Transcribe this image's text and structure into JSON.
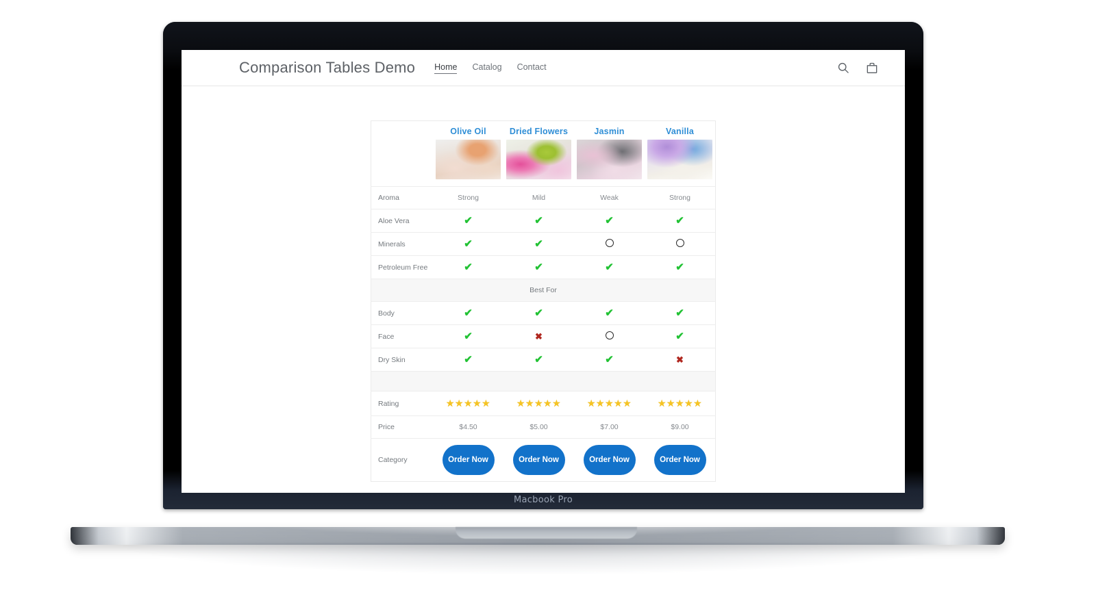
{
  "device": {
    "label": "Macbook Pro"
  },
  "header": {
    "brand": "Comparison Tables Demo",
    "nav": [
      {
        "label": "Home",
        "active": true
      },
      {
        "label": "Catalog",
        "active": false
      },
      {
        "label": "Contact",
        "active": false
      }
    ],
    "icons": [
      {
        "name": "search-icon",
        "label": "Search"
      },
      {
        "name": "shopping-bag-icon",
        "label": "Cart"
      }
    ]
  },
  "colors": {
    "product_title": "#2f8ed6",
    "check": "#22c234",
    "cross": "#b0271f",
    "star": "#f6c424",
    "button": "#1272ca",
    "section_band": "#f7f7f7"
  },
  "table": {
    "products": [
      {
        "name": "Olive Oil",
        "image": "olive-oil-soap-photo"
      },
      {
        "name": "Dried Flowers",
        "image": "dried-flowers-soap-photo"
      },
      {
        "name": "Jasmin",
        "image": "jasmin-soap-photo"
      },
      {
        "name": "Vanilla",
        "image": "vanilla-soap-photo"
      }
    ],
    "rows": [
      {
        "type": "text",
        "label": "Aroma",
        "values": [
          "Strong",
          "Mild",
          "Weak",
          "Strong"
        ]
      },
      {
        "type": "mark",
        "label": "Aloe Vera",
        "values": [
          "check",
          "check",
          "check",
          "check"
        ]
      },
      {
        "type": "mark",
        "label": "Minerals",
        "values": [
          "check",
          "check",
          "circle",
          "circle"
        ]
      },
      {
        "type": "mark",
        "label": "Petroleum Free",
        "values": [
          "check",
          "check",
          "check",
          "check"
        ]
      },
      {
        "type": "section",
        "label": "Best For"
      },
      {
        "type": "mark",
        "label": "Body",
        "values": [
          "check",
          "check",
          "check",
          "check"
        ]
      },
      {
        "type": "mark",
        "label": "Face",
        "values": [
          "check",
          "cross",
          "circle",
          "check"
        ]
      },
      {
        "type": "mark",
        "label": "Dry Skin",
        "values": [
          "check",
          "check",
          "check",
          "cross"
        ]
      },
      {
        "type": "section",
        "label": ""
      },
      {
        "type": "stars",
        "label": "Rating",
        "values": [
          5,
          5,
          5,
          5
        ]
      },
      {
        "type": "text",
        "label": "Price",
        "values": [
          "$4.50",
          "$5.00",
          "$7.00",
          "$9.00"
        ]
      },
      {
        "type": "button",
        "label": "Category",
        "values": [
          "Order Now",
          "Order Now",
          "Order Now",
          "Order Now"
        ]
      }
    ]
  }
}
